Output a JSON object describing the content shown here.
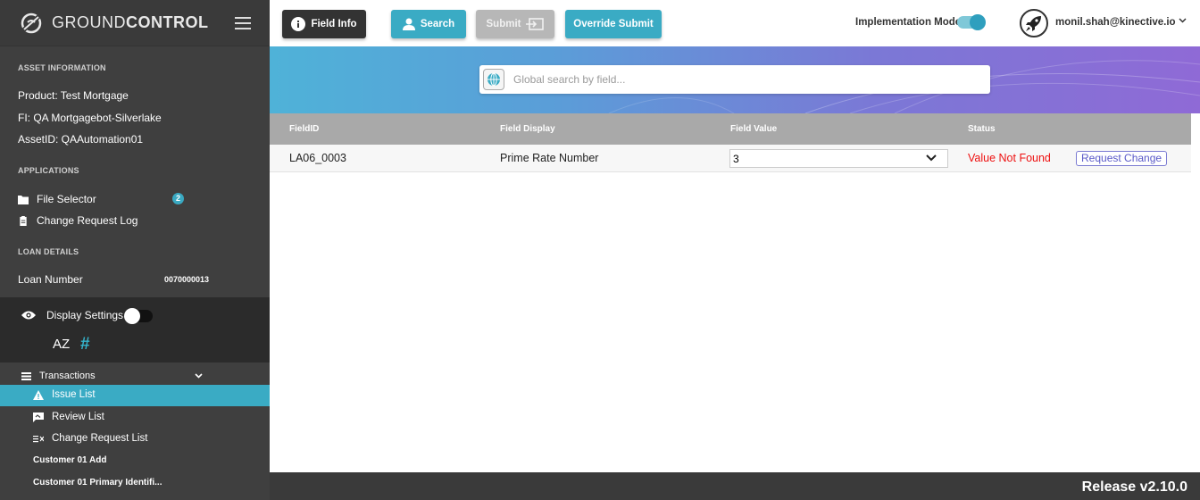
{
  "brand": {
    "prefix": "GROUND",
    "suffix": "CONTROL"
  },
  "sidebar": {
    "asset_title": "ASSET INFORMATION",
    "product": "Product:  Test Mortgage",
    "fi": "FI:  QA Mortgagebot-Silverlake",
    "asset_id": "AssetID:  QAAutomation01",
    "apps_title": "APPLICATIONS",
    "file_selector": "File Selector",
    "file_selector_badge": "2",
    "change_request_log": "Change Request Log",
    "loan_title": "LOAN DETAILS",
    "loan_number_label": "Loan Number",
    "loan_number_value": "0070000013",
    "display_settings": "Display Settings",
    "sort_label": "AZ",
    "hash_label": "#",
    "transactions": "Transactions",
    "issue_list": "Issue List",
    "review_list": "Review List",
    "change_request_list": "Change Request List",
    "customer_add": "Customer 01 Add",
    "customer_primary": "Customer 01 Primary Identifi..."
  },
  "toolbar": {
    "field_info": "Field Info",
    "search": "Search",
    "submit": "Submit",
    "override_submit": "Override Submit",
    "implementation_mode": "Implementation Mode",
    "user_email": "monil.shah@kinective.io"
  },
  "search": {
    "placeholder": "Global search by field..."
  },
  "table": {
    "headers": [
      "FieldID",
      "Field Display",
      "Field Value",
      "Status"
    ],
    "rows": [
      {
        "field_id": "LA06_0003",
        "field_display": "Prime Rate Number",
        "field_value": "3",
        "status": "Value Not Found",
        "action": "Request Change"
      }
    ]
  },
  "footer": {
    "release": "Release v2.10.0"
  },
  "colors": {
    "accent": "#3aabc4",
    "sidebar": "#3f3f3f",
    "status_error": "#e11111"
  }
}
